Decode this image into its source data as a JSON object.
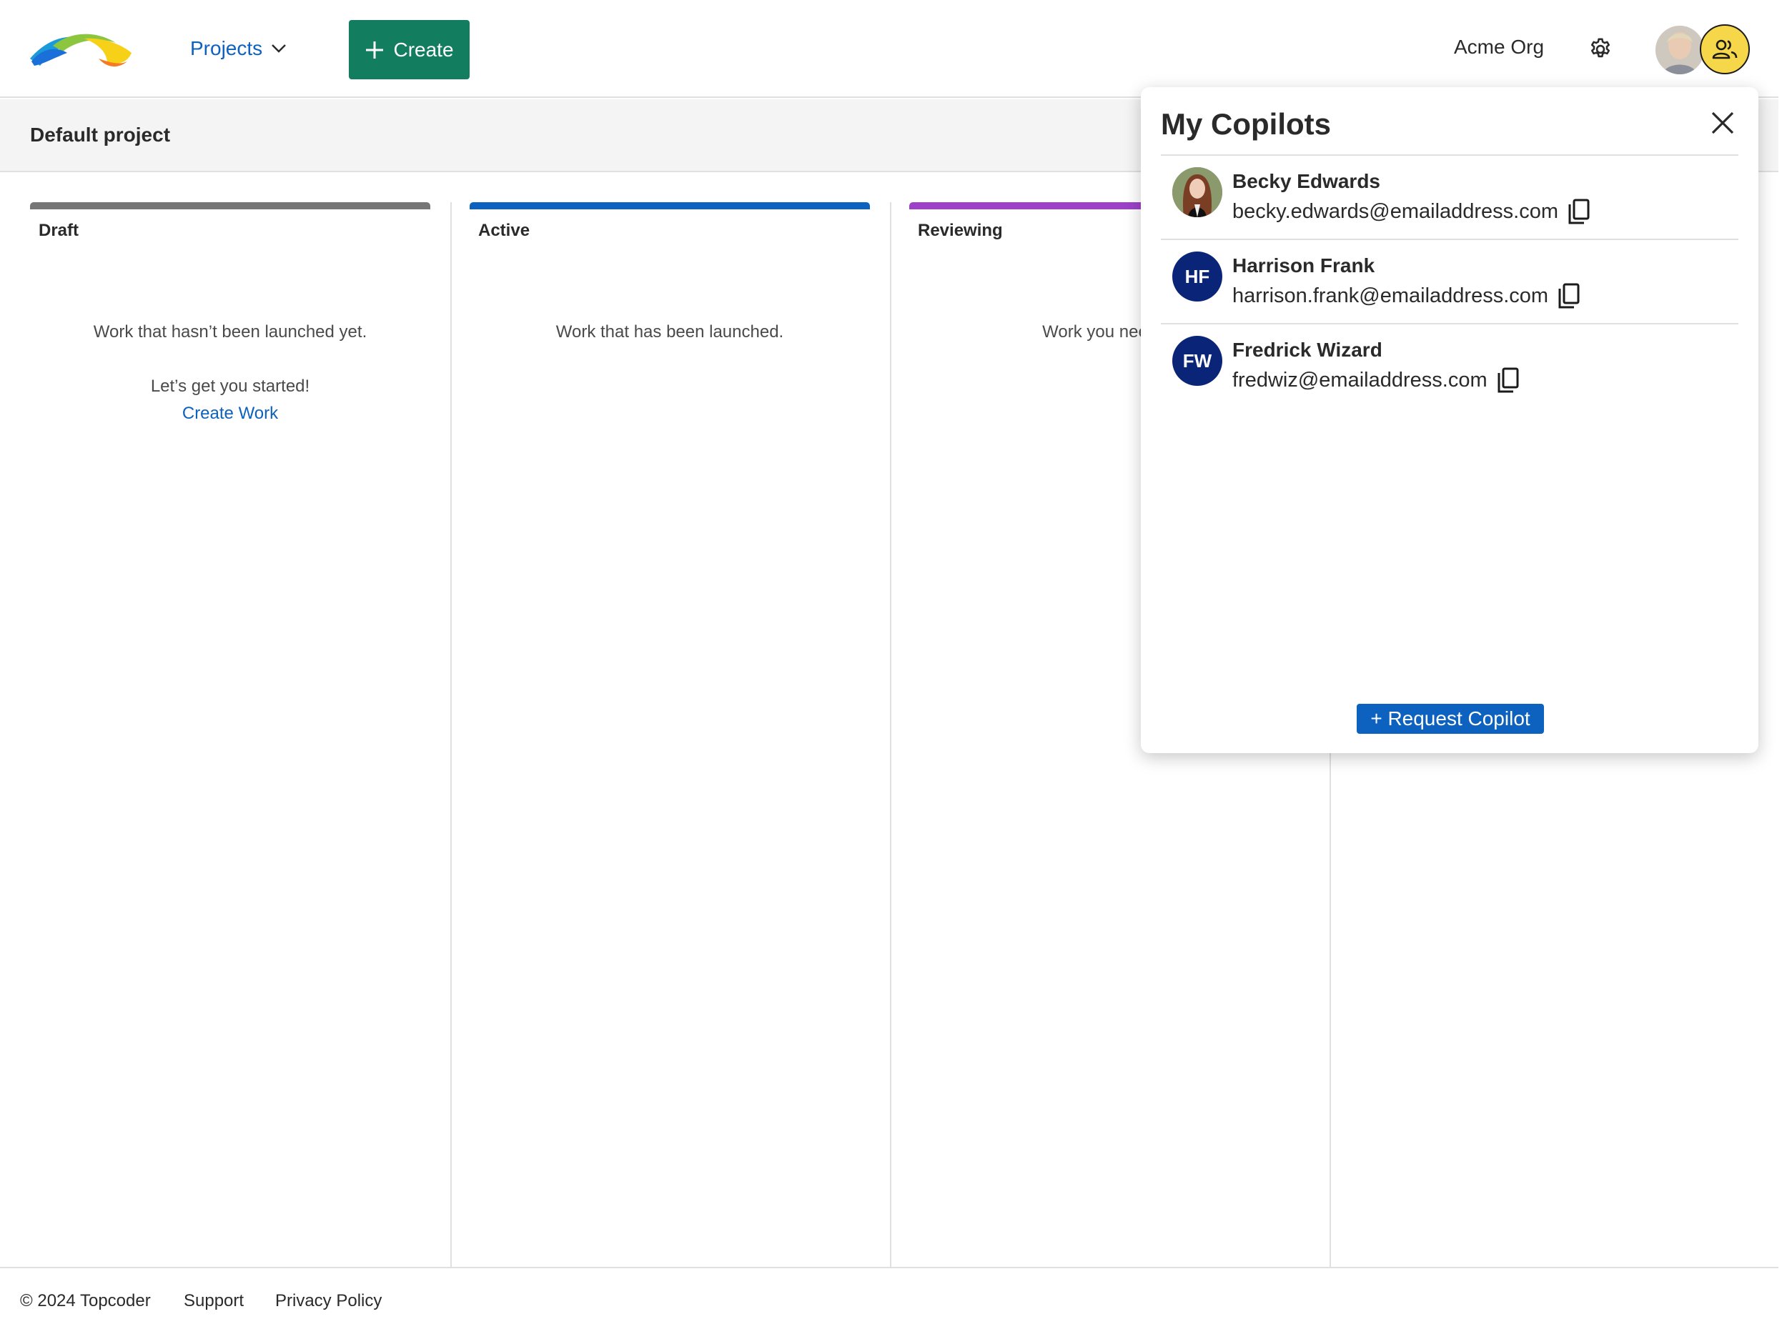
{
  "header": {
    "nav_projects": "Projects",
    "create_label": "Create",
    "org_name": "Acme Org"
  },
  "subheader": {
    "title": "Default project"
  },
  "columns": [
    {
      "title": "Draft",
      "color": "#767676",
      "description": "Work that hasn’t been launched yet.",
      "subtext": "Let’s get you started!",
      "link": "Create Work"
    },
    {
      "title": "Active",
      "color": "#0d61bf",
      "description": "Work that has been launched."
    },
    {
      "title": "Reviewing",
      "color": "#9d41c9",
      "description": "Work you need to"
    }
  ],
  "copilots_panel": {
    "title": "My Copilots",
    "copilots": [
      {
        "name": "Becky Edwards",
        "email": "becky.edwards@emailaddress.com",
        "initials": ""
      },
      {
        "name": "Harrison Frank",
        "email": "harrison.frank@emailaddress.com",
        "initials": "HF"
      },
      {
        "name": "Fredrick Wizard",
        "email": "fredwiz@emailaddress.com",
        "initials": "FW"
      }
    ],
    "request_label": "+ Request Copilot"
  },
  "footer": {
    "copyright": "© 2024 Topcoder",
    "support": "Support",
    "privacy": "Privacy Policy"
  },
  "colors": {
    "primary_blue": "#0d61bf",
    "create_green": "#137d60",
    "avatar_navy": "#0a2478",
    "copilot_badge_yellow": "#f7d74a"
  }
}
